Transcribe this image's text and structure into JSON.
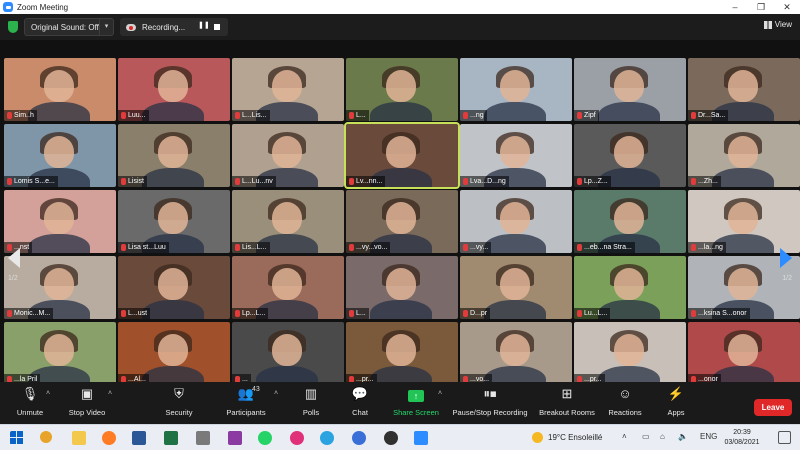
{
  "window": {
    "title": "Zoom Meeting",
    "controls": [
      "–",
      "❐",
      "✕"
    ]
  },
  "topbar": {
    "sound_label": "Original Sound: Off",
    "recording_label": "Recording...",
    "view_label": "View"
  },
  "gallery": {
    "page_left": "1/2",
    "page_right": "1/2",
    "tiles": [
      {
        "name": "Sim..h",
        "bg": "#c98b6a"
      },
      {
        "name": "Luu...",
        "bg": "#b9585a"
      },
      {
        "name": "L...Lis...",
        "bg": "#b5a592"
      },
      {
        "name": "L...",
        "bg": "#6a7a4a"
      },
      {
        "name": "...ng",
        "bg": "#a8b6c4"
      },
      {
        "name": "Zipf",
        "bg": "#9aa0a6"
      },
      {
        "name": "Dr...Sa...",
        "bg": "#7b6a5c"
      },
      {
        "name": "Lomis S...e...",
        "bg": "#7f95a8"
      },
      {
        "name": "Lisist",
        "bg": "#8a7f6a"
      },
      {
        "name": "L...Lu...nv",
        "bg": "#b0a090"
      },
      {
        "name": "Lv...nn...",
        "bg": "#6a4a3a"
      },
      {
        "name": "Lva...D...ng",
        "bg": "#c0c4c8"
      },
      {
        "name": "Lp...Z...",
        "bg": "#5a5a5a"
      },
      {
        "name": "...Zh...",
        "bg": "#b0a89a"
      },
      {
        "name": "...nst",
        "bg": "#d4a09a"
      },
      {
        "name": "Lisa st...Luu",
        "bg": "#6a6a6a"
      },
      {
        "name": "Lis...L...",
        "bg": "#9a8f7a"
      },
      {
        "name": "...vy...vo...",
        "bg": "#7a6a5a"
      },
      {
        "name": "...vy...",
        "bg": "#bcc0c4"
      },
      {
        "name": "...eb...na Stra...",
        "bg": "#5a7a6a"
      },
      {
        "name": "...la...ng",
        "bg": "#d0c8c0"
      },
      {
        "name": "Monic...M...",
        "bg": "#b8aca0"
      },
      {
        "name": "L...ust",
        "bg": "#6a4a3a"
      },
      {
        "name": "Lp...L...",
        "bg": "#9a6a5a"
      },
      {
        "name": "L...",
        "bg": "#7a6a6a"
      },
      {
        "name": "D...pr",
        "bg": "#a08a70"
      },
      {
        "name": "Lu...L...",
        "bg": "#7aa05a"
      },
      {
        "name": "...ksina S...onor",
        "bg": "#b0b4b8"
      },
      {
        "name": "...la Pril",
        "bg": "#8aa06a"
      },
      {
        "name": "...Al...",
        "bg": "#a0502a"
      },
      {
        "name": "...",
        "bg": "#4a4a4a"
      },
      {
        "name": "...pr...",
        "bg": "#7a5a3a"
      },
      {
        "name": "...vo...",
        "bg": "#a89a8a"
      },
      {
        "name": "...pr...",
        "bg": "#c8c0b8"
      },
      {
        "name": "...onor",
        "bg": "#b04a4a"
      }
    ]
  },
  "toolbar": {
    "unmute": "Unmute",
    "stop_video": "Stop Video",
    "security": "Security",
    "participants": "Participants",
    "participants_count": "43",
    "polls": "Polls",
    "chat": "Chat",
    "share_screen": "Share Screen",
    "pause_stop_recording": "Pause/Stop Recording",
    "breakout_rooms": "Breakout Rooms",
    "reactions": "Reactions",
    "apps": "Apps",
    "leave": "Leave"
  },
  "taskbar": {
    "weather": "19°C  Ensoleillé",
    "lang": "ENG",
    "time": "20:39",
    "date": "03/08/2021"
  },
  "colors": {
    "zoom_blue": "#2d8cff",
    "share_green": "#23d96b",
    "leave_red": "#e02828",
    "active_speaker": "#c7e05a"
  }
}
